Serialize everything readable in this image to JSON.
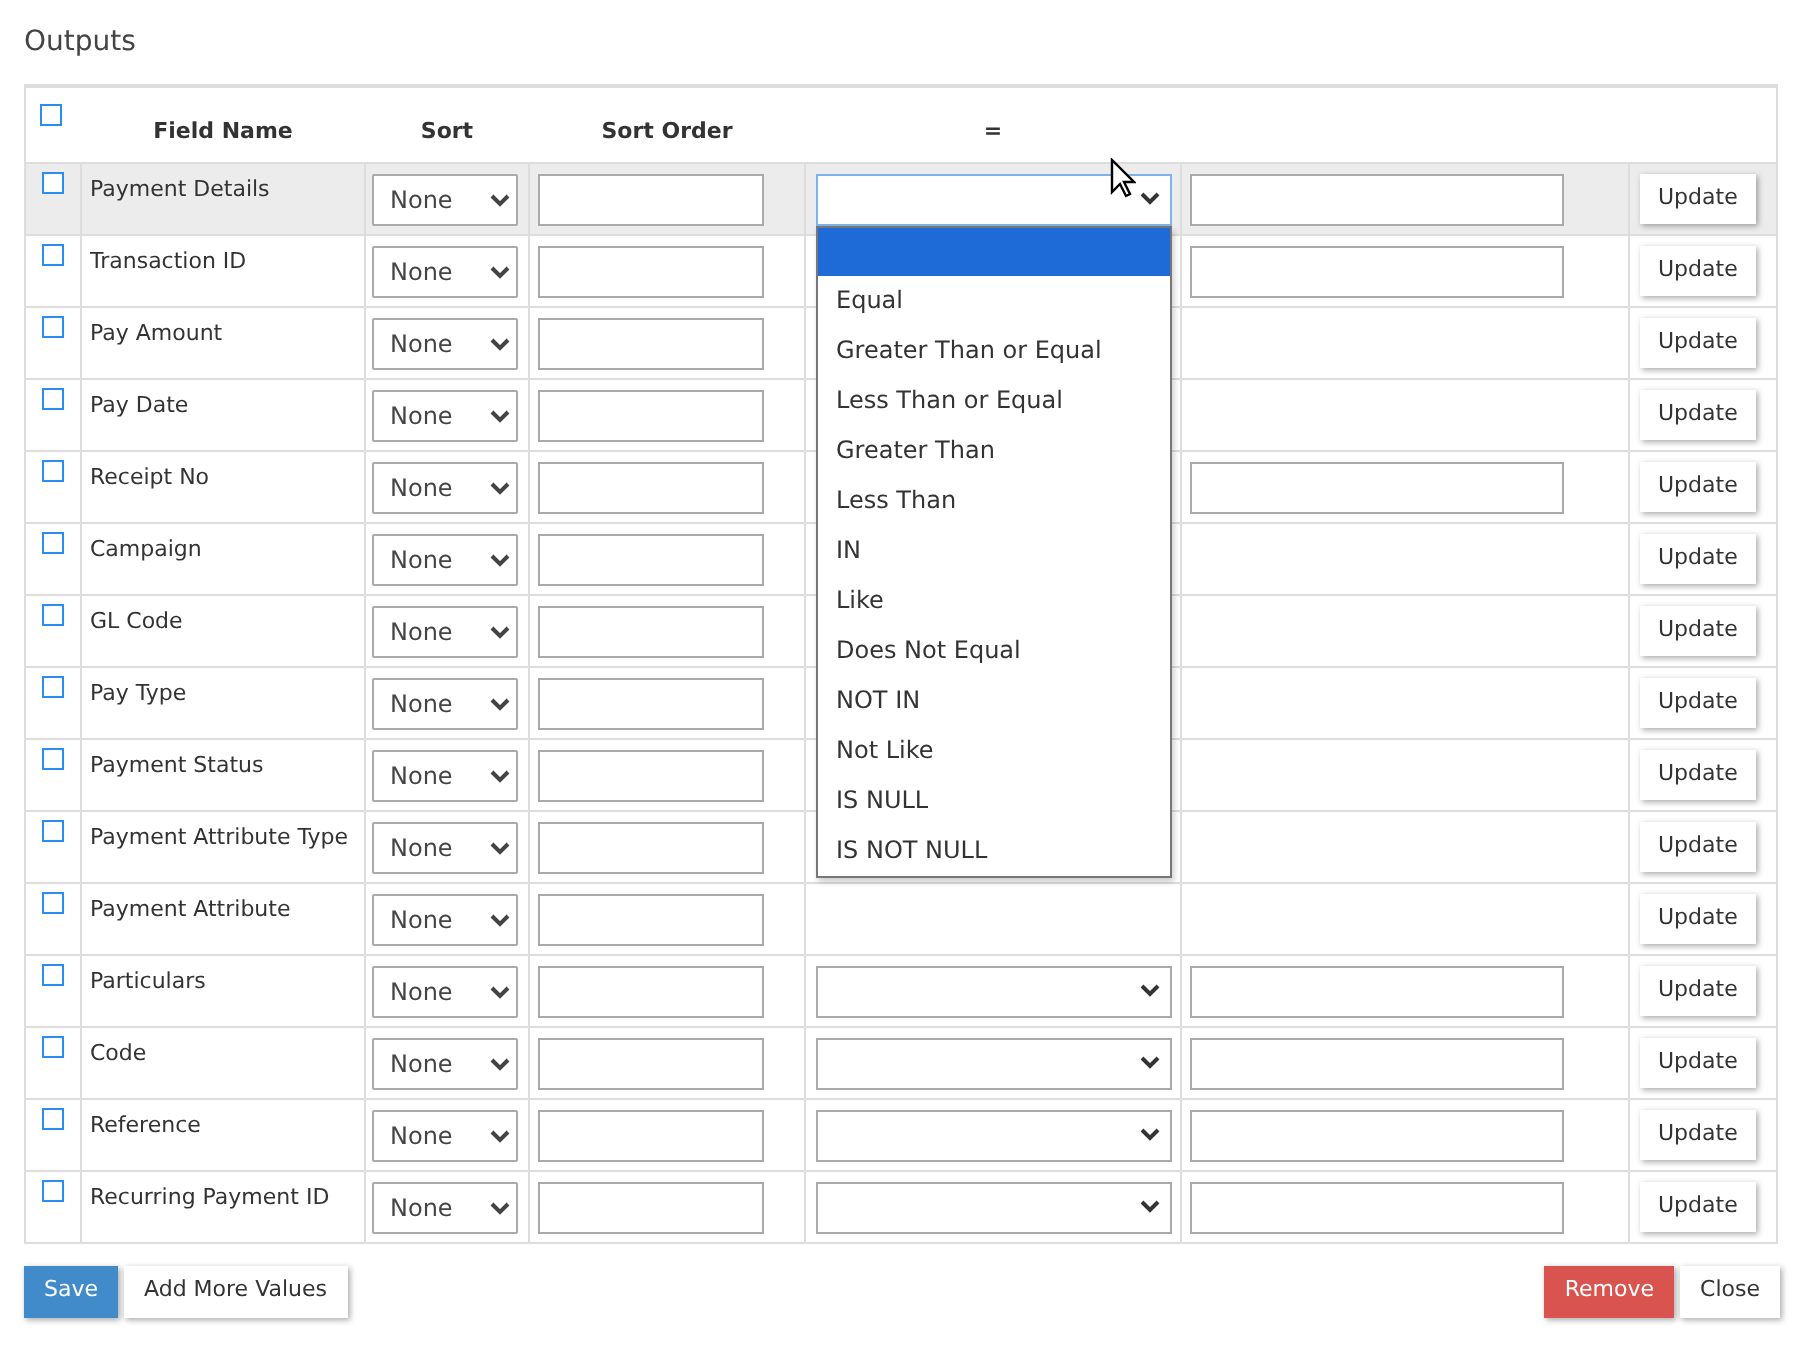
{
  "title": "Outputs",
  "header": {
    "checked": false,
    "columns": [
      "Field Name",
      "Sort",
      "Sort Order",
      "="
    ]
  },
  "rows": [
    {
      "name": "Payment Details",
      "checked": false,
      "hovered": true,
      "sort": "None",
      "kind": "full",
      "button": "Update"
    },
    {
      "name": "Transaction ID",
      "checked": false,
      "hovered": false,
      "sort": "None",
      "kind": "value_only",
      "button": "Update"
    },
    {
      "name": "Pay Amount",
      "checked": false,
      "hovered": false,
      "sort": "None",
      "kind": "plain",
      "button": "Update"
    },
    {
      "name": "Pay Date",
      "checked": false,
      "hovered": false,
      "sort": "None",
      "kind": "plain",
      "button": "Update"
    },
    {
      "name": "Receipt No",
      "checked": false,
      "hovered": false,
      "sort": "None",
      "kind": "value_only",
      "button": "Update"
    },
    {
      "name": "Campaign",
      "checked": false,
      "hovered": false,
      "sort": "None",
      "kind": "plain",
      "button": "Update"
    },
    {
      "name": "GL Code",
      "checked": false,
      "hovered": false,
      "sort": "None",
      "kind": "plain",
      "button": "Update"
    },
    {
      "name": "Pay Type",
      "checked": false,
      "hovered": false,
      "sort": "None",
      "kind": "plain",
      "button": "Update"
    },
    {
      "name": "Payment Status",
      "checked": false,
      "hovered": false,
      "sort": "None",
      "kind": "plain",
      "button": "Update"
    },
    {
      "name": "Payment Attribute Type",
      "checked": false,
      "hovered": false,
      "sort": "None",
      "kind": "plain",
      "button": "Update"
    },
    {
      "name": "Payment Attribute",
      "checked": false,
      "hovered": false,
      "sort": "None",
      "kind": "plain",
      "button": "Update"
    },
    {
      "name": "Particulars",
      "checked": false,
      "hovered": false,
      "sort": "None",
      "kind": "full",
      "button": "Update"
    },
    {
      "name": "Code",
      "checked": false,
      "hovered": false,
      "sort": "None",
      "kind": "full",
      "button": "Update"
    },
    {
      "name": "Reference",
      "checked": false,
      "hovered": false,
      "sort": "None",
      "kind": "full",
      "button": "Update"
    },
    {
      "name": "Recurring Payment ID",
      "checked": false,
      "hovered": false,
      "sort": "None",
      "kind": "full",
      "button": "Update"
    }
  ],
  "dropdown": {
    "blank_option_selected": true,
    "options": [
      "Equal",
      "Greater Than or Equal",
      "Less Than or Equal",
      "Greater Than",
      "Less Than",
      "IN",
      "Like",
      "Does Not Equal",
      "NOT IN",
      "Not Like",
      "IS NULL",
      "IS NOT NULL"
    ]
  },
  "footer": {
    "left": [
      {
        "label": "Save",
        "kind": "primary"
      },
      {
        "label": "Add More Values",
        "kind": "default"
      }
    ],
    "right": [
      {
        "label": "Remove",
        "kind": "danger"
      },
      {
        "label": "Close",
        "kind": "default"
      }
    ]
  }
}
